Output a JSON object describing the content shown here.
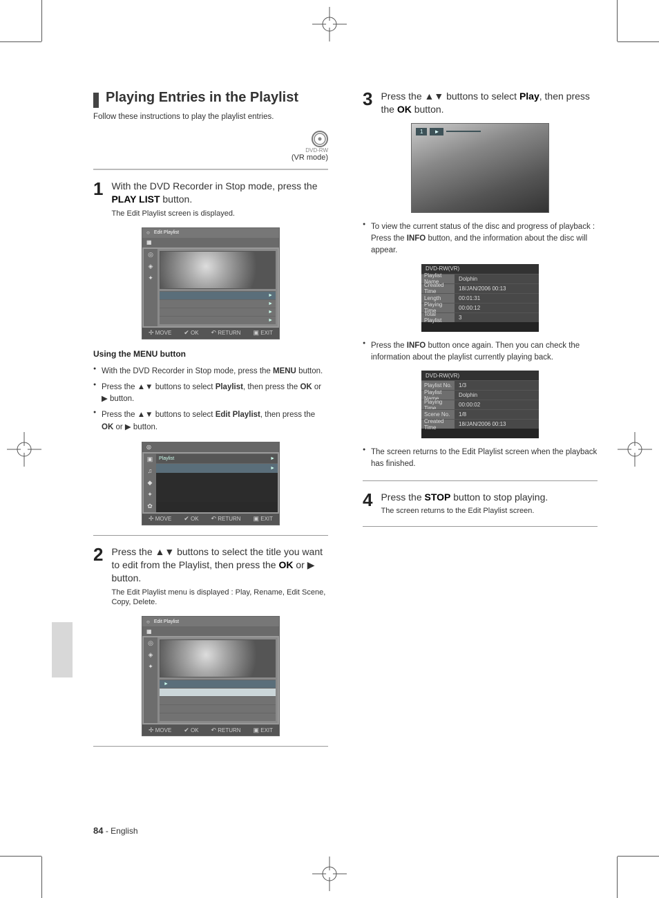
{
  "page": {
    "footer_page": "84",
    "footer_lang": "- English"
  },
  "heading": {
    "title": "Playing Entries in the Playlist",
    "intro": "Follow these instructions to play the playlist entries.",
    "disc_badge": "DVD-RW",
    "mode_note": "(VR mode)"
  },
  "left": {
    "step1": {
      "num": "1",
      "head_a": "With the DVD Recorder in Stop mode, press the ",
      "head_btn": "PLAY LIST",
      "head_b": " button.",
      "desc": "The Edit Playlist screen is displayed."
    },
    "menu_bullets": [
      {
        "a": "With the DVD Recorder in Stop mode, press the ",
        "btn": "MENU",
        "b": " button."
      },
      {
        "a": "Press the ▲▼ buttons to select ",
        "btn": "Playlist",
        "b": ", then press the ",
        "btn2": "OK",
        "c": " or ▶ button."
      },
      {
        "a": "Press the ▲▼ buttons to select ",
        "btn": "Edit Playlist",
        "b": ", then press the ",
        "btn2": "OK",
        "c": " or ▶ button."
      }
    ],
    "step2": {
      "num": "2",
      "head": "Press the ▲▼ buttons to select the title you want to edit from the Playlist, then press the ",
      "btn": "OK",
      "head_b": " or ▶ button.",
      "desc": "The Edit Playlist menu is displayed : Play, Rename, Edit Scene, Copy, Delete."
    },
    "osd1_title": "Edit Playlist",
    "osd2_title": "Playlist",
    "osd3_title": "Edit Playlist",
    "osd_footer": {
      "move": "MOVE",
      "ok": "OK",
      "ret": "RETURN",
      "exit": "EXIT"
    }
  },
  "right": {
    "step3": {
      "num": "3",
      "head_a": "Press the ▲▼ buttons to select ",
      "btn_sel": "Play",
      "head_b": ", then press the ",
      "btn_ok": "OK",
      "head_c": " button."
    },
    "play_badge_num": "1",
    "play_badge_txt": "►",
    "bullet1_a": "To view the current status of the disc and progress of playback : Press the ",
    "bullet1_btn": "INFO",
    "bullet1_b": " button, and the information about the disc will appear.",
    "bullet2_a": "Press the ",
    "bullet2_btn": "INFO",
    "bullet2_b": " button once again. Then you can check the information about the playlist currently playing back.",
    "bullet3": "The screen returns to the Edit Playlist screen when the playback has finished.",
    "step4": {
      "num": "4",
      "head_a": "Press the ",
      "btn": "STOP",
      "head_b": " button to stop playing.",
      "desc": "The screen returns to the Edit Playlist screen."
    },
    "info1": {
      "head": "DVD-RW(VR)",
      "rows": [
        {
          "lbl": "Playlist Name",
          "val": "Dolphin"
        },
        {
          "lbl": "Created Time",
          "val": "18/JAN/2006 00:13"
        },
        {
          "lbl": "Length",
          "val": "00:01:31"
        },
        {
          "lbl": "Playing Time",
          "val": "00:00:12"
        },
        {
          "lbl": "Total Playlist",
          "val": "3"
        }
      ]
    },
    "info2": {
      "head": "DVD-RW(VR)",
      "rows": [
        {
          "lbl": "Playlist No.",
          "val": "1/3"
        },
        {
          "lbl": "Playlist Name",
          "val": "Dolphin"
        },
        {
          "lbl": "Playing Time",
          "val": "00:00:02"
        },
        {
          "lbl": "Scene No.",
          "val": "1/8"
        },
        {
          "lbl": "Created Time",
          "val": "18/JAN/2006 00:13"
        }
      ]
    }
  }
}
